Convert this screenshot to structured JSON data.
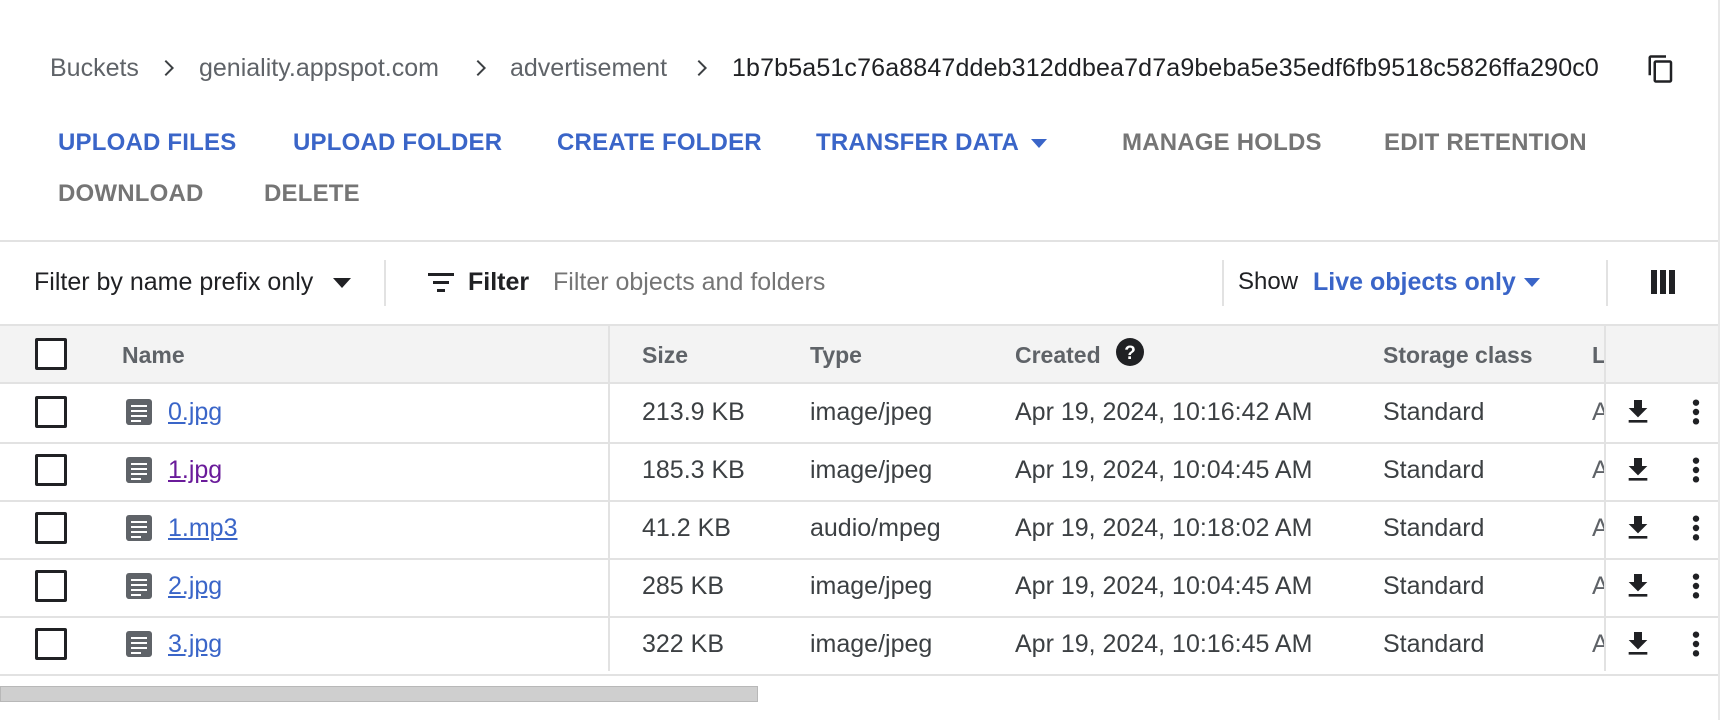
{
  "breadcrumb": {
    "items": [
      "Buckets",
      "geniality.appspot.com",
      "advertisement"
    ],
    "current": "1b7b5a51c76a8847ddeb312ddbea7d7a9beba5e35edf6fb9518c5826ffa290c0",
    "copy_icon": "copy-icon"
  },
  "toolbar": {
    "upload_files": "UPLOAD FILES",
    "upload_folder": "UPLOAD FOLDER",
    "create_folder": "CREATE FOLDER",
    "transfer_data": "TRANSFER DATA",
    "manage_holds": "MANAGE HOLDS",
    "edit_retention": "EDIT RETENTION",
    "download": "DOWNLOAD",
    "delete": "DELETE"
  },
  "filter_bar": {
    "mode": "Filter by name prefix only",
    "filter_label": "Filter",
    "placeholder": "Filter objects and folders",
    "show_label": "Show",
    "show_value": "Live objects only"
  },
  "table": {
    "columns": {
      "name": "Name",
      "size": "Size",
      "type": "Type",
      "created": "Created",
      "storage_class": "Storage class",
      "last_truncated": "L"
    },
    "rows": [
      {
        "name": "0.jpg",
        "size": "213.9 KB",
        "type": "image/jpeg",
        "created": "Apr 19, 2024, 10:16:42 AM",
        "storage_class": "Standard",
        "truncated": "A"
      },
      {
        "name": "1.jpg",
        "size": "185.3 KB",
        "type": "image/jpeg",
        "created": "Apr 19, 2024, 10:04:45 AM",
        "storage_class": "Standard",
        "truncated": "A"
      },
      {
        "name": "1.mp3",
        "size": "41.2 KB",
        "type": "audio/mpeg",
        "created": "Apr 19, 2024, 10:18:02 AM",
        "storage_class": "Standard",
        "truncated": "A"
      },
      {
        "name": "2.jpg",
        "size": "285 KB",
        "type": "image/jpeg",
        "created": "Apr 19, 2024, 10:04:45 AM",
        "storage_class": "Standard",
        "truncated": "A"
      },
      {
        "name": "3.jpg",
        "size": "322 KB",
        "type": "image/jpeg",
        "created": "Apr 19, 2024, 10:16:45 AM",
        "storage_class": "Standard",
        "truncated": "A"
      }
    ]
  },
  "colors": {
    "accent_blue": "#3a65c8",
    "visited_purple": "#6a1b9a",
    "disabled_gray": "#757575"
  }
}
